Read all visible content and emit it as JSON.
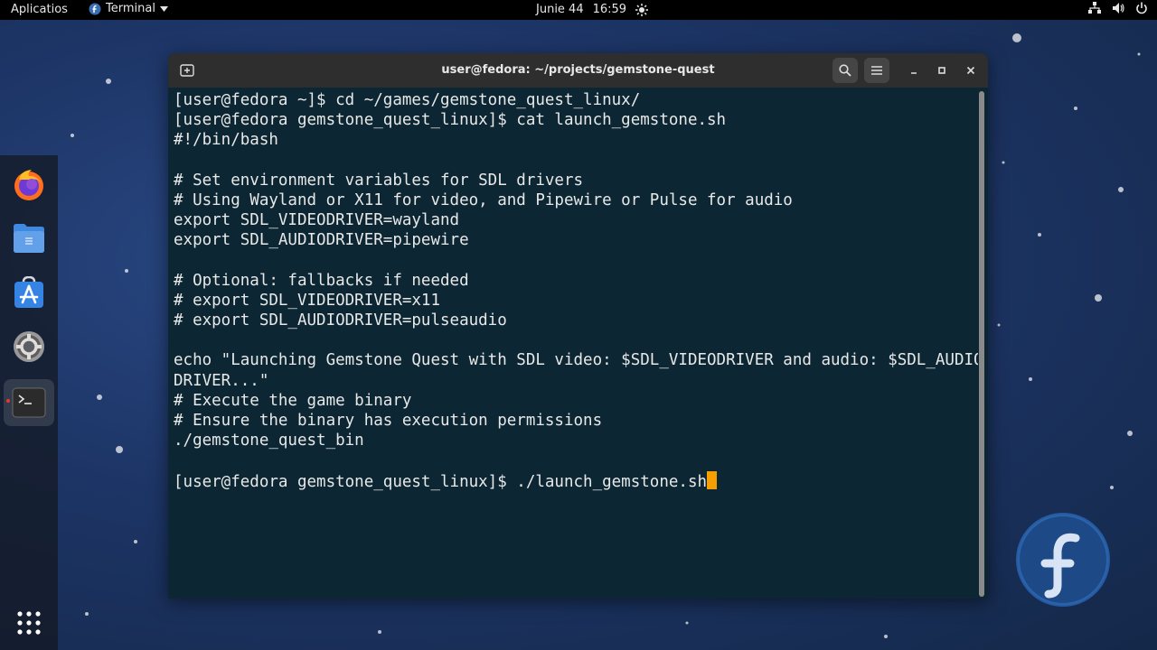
{
  "topbar": {
    "apps_label": "Aplicatios",
    "app_menu_label": "Terminal",
    "date": "Junie 44",
    "time": "16:59"
  },
  "dock": {
    "items": [
      {
        "name": "firefox",
        "icon": "firefox-icon"
      },
      {
        "name": "files",
        "icon": "folder-icon"
      },
      {
        "name": "software",
        "icon": "app-store-icon"
      },
      {
        "name": "settings",
        "icon": "gear-icon"
      },
      {
        "name": "terminal",
        "icon": "terminal-icon",
        "active": true
      },
      {
        "name": "show-apps",
        "icon": "grid-icon"
      }
    ]
  },
  "window": {
    "title": "user@fedora: ~/projects/gemstone-quest",
    "bg_color": "#0c2733"
  },
  "terminal": {
    "lines": [
      "[user@fedora ~]$ cd ~/games/gemstone_quest_linux/",
      "[user@fedora gemstone_quest_linux]$ cat launch_gemstone.sh",
      "#!/bin/bash",
      "",
      "# Set environment variables for SDL drivers",
      "# Using Wayland or X11 for video, and Pipewire or Pulse for audio",
      "export SDL_VIDEODRIVER=wayland",
      "export SDL_AUDIODRIVER=pipewire",
      "",
      "# Optional: fallbacks if needed",
      "# export SDL_VIDEODRIVER=x11",
      "# export SDL_AUDIODRIVER=pulseaudio",
      "",
      "echo \"Launching Gemstone Quest with SDL video: $SDL_VIDEODRIVER and audio: $SDL_AUDIO",
      "DRIVER...\"",
      "# Execute the game binary",
      "# Ensure the binary has execution permissions",
      "./gemstone_quest_bin",
      "",
      "[user@fedora gemstone_quest_linux]$ ./launch_gemstone.sh"
    ]
  },
  "colors": {
    "cursor": "#f5a000",
    "topbar": "#000000",
    "titlebar": "#2e2e2e"
  }
}
